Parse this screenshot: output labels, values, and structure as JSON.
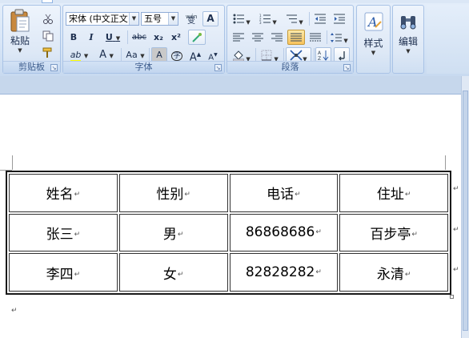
{
  "ribbon": {
    "clipboard": {
      "paste_label": "粘贴",
      "group_label": "剪贴板"
    },
    "font": {
      "font_name": "宋体 (中文正文",
      "font_size": "五号",
      "group_label": "字体",
      "bold": "B",
      "italic": "I",
      "underline": "U",
      "strikethrough": "abc",
      "subscript": "x₂",
      "superscript": "x²",
      "highlight": "ab",
      "font_color": "A",
      "change_case": "Aa",
      "char_shading": "A",
      "enclose": "字",
      "grow": "A",
      "shrink": "A",
      "phonetic": "wén",
      "clear": "A"
    },
    "paragraph": {
      "group_label": "段落"
    },
    "styles": {
      "label": "样式"
    },
    "editing": {
      "label": "编辑"
    }
  },
  "document": {
    "table": {
      "rows": [
        [
          "姓名",
          "性别",
          "电话",
          "住址"
        ],
        [
          "张三",
          "男",
          "86868686",
          "百步亭"
        ],
        [
          "李四",
          "女",
          "82828282",
          "永清"
        ]
      ]
    },
    "paragraph_mark": "↵"
  }
}
